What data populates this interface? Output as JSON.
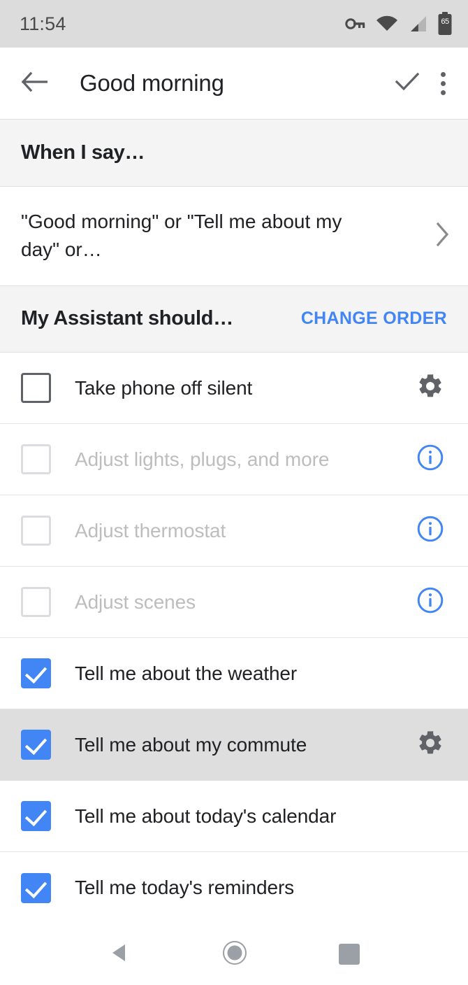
{
  "status_bar": {
    "clock": "11:54",
    "battery_level": "65",
    "icons": [
      "vpn-key-icon",
      "wifi-icon",
      "cell-signal-icon",
      "battery-icon"
    ],
    "background_color": "#dcdcdc"
  },
  "app_bar": {
    "back_icon": "arrow-back-icon",
    "title": "Good morning",
    "confirm_icon": "check-icon",
    "overflow_icon": "more-vert-icon"
  },
  "sections": {
    "when_i_say": {
      "title": "When I say…",
      "phrase": "\"Good morning\" or \"Tell me about my day\" or…",
      "chevron_icon": "chevron-right-icon"
    },
    "assistant_should": {
      "title": "My Assistant should…",
      "action_label": "CHANGE ORDER",
      "action_color": "#4285f4"
    }
  },
  "action_rows": [
    {
      "label": "Take phone off silent",
      "checked": false,
      "enabled": true,
      "trailing_icon": "settings-gear-icon",
      "highlighted": false
    },
    {
      "label": "Adjust lights, plugs, and more",
      "checked": false,
      "enabled": false,
      "trailing_icon": "info-circle-icon",
      "highlighted": false
    },
    {
      "label": "Adjust thermostat",
      "checked": false,
      "enabled": false,
      "trailing_icon": "info-circle-icon",
      "highlighted": false
    },
    {
      "label": "Adjust scenes",
      "checked": false,
      "enabled": false,
      "trailing_icon": "info-circle-icon",
      "highlighted": false
    },
    {
      "label": "Tell me about the weather",
      "checked": true,
      "enabled": true,
      "trailing_icon": "none",
      "highlighted": false
    },
    {
      "label": "Tell me about my commute",
      "checked": true,
      "enabled": true,
      "trailing_icon": "settings-gear-icon",
      "highlighted": true
    },
    {
      "label": "Tell me about today's calendar",
      "checked": true,
      "enabled": true,
      "trailing_icon": "none",
      "highlighted": false
    },
    {
      "label": "Tell me today's reminders",
      "checked": true,
      "enabled": true,
      "trailing_icon": "none",
      "highlighted": false
    }
  ],
  "nav_bar": {
    "back": "nav-back-triangle-icon",
    "home": "nav-home-circle-icon",
    "recents": "nav-recents-square-icon"
  },
  "colors": {
    "accent_blue": "#4285f4",
    "text_primary": "#202124",
    "text_disabled": "#bdbdbd",
    "icon_gray": "#5f6368",
    "section_bg": "#f4f4f4",
    "row_highlight": "#dedede"
  }
}
